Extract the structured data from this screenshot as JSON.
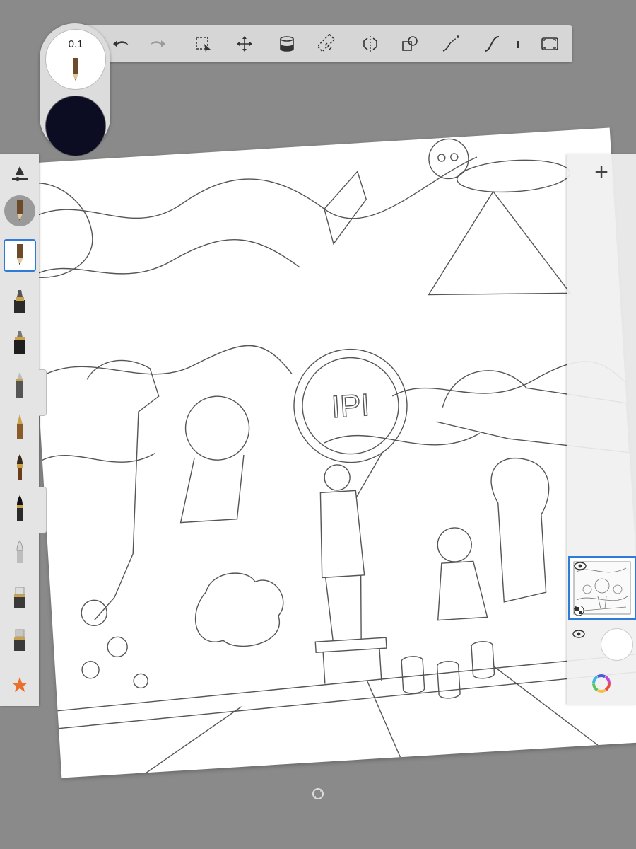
{
  "brush": {
    "size_label": "0.1",
    "color": "#0c0d22"
  },
  "toolbar": {
    "tools": [
      {
        "name": "undo-icon"
      },
      {
        "name": "redo-icon"
      },
      {
        "name": "selection-icon"
      },
      {
        "name": "transform-icon"
      },
      {
        "name": "fill-icon"
      },
      {
        "name": "ruler-icon"
      },
      {
        "name": "symmetry-icon"
      },
      {
        "name": "shapes-icon"
      },
      {
        "name": "perspective-icon"
      },
      {
        "name": "steady-stroke-icon"
      },
      {
        "name": "more-icon"
      },
      {
        "name": "fullscreen-icon"
      }
    ]
  },
  "palette": {
    "items": [
      {
        "name": "brush-settings-icon"
      },
      {
        "name": "pencil-brush-icon"
      },
      {
        "name": "pencil-brush-icon",
        "selected": true
      },
      {
        "name": "marker-brush-icon"
      },
      {
        "name": "felt-brush-icon"
      },
      {
        "name": "ballpoint-brush-icon"
      },
      {
        "name": "fountain-pen-brush-icon"
      },
      {
        "name": "paintbrush-icon"
      },
      {
        "name": "ink-brush-icon"
      },
      {
        "name": "airbrush-icon"
      },
      {
        "name": "smudge-brush-icon"
      },
      {
        "name": "eraser-brush-icon"
      },
      {
        "name": "favorites-star-icon"
      }
    ]
  },
  "layers": {
    "add_symbol": "+",
    "items": [
      {
        "name": "drawing-layer",
        "visible": true
      },
      {
        "name": "background-layer",
        "visible": true
      }
    ]
  },
  "colors": {
    "toolbar_bg": "#d6d6d6",
    "palette_bg": "#e4e4e4",
    "accent": "#2f7bd8",
    "workspace_bg": "#8a8a8a"
  }
}
